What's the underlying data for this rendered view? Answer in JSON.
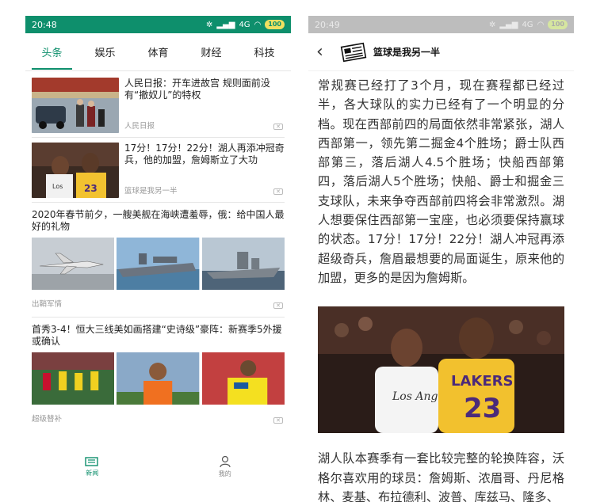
{
  "left": {
    "status": {
      "time": "20:48",
      "network": "4G",
      "battery": "100"
    },
    "tabs": [
      "头条",
      "娱乐",
      "体育",
      "财经",
      "科技"
    ],
    "news": [
      {
        "title": "人民日报：开车进故宫 规则面前没有“撤奴儿”的特权",
        "source": "人民日报"
      },
      {
        "title": "17分！17分！22分！湖人再添冲冠奇兵，他的加盟，詹姆斯立了大功",
        "source": "篮球是我另一半"
      },
      {
        "title": "2020年春节前夕，一艘美舰在海峡遭羞辱，俄：给中国人最好的礼物",
        "source": "出鞘军情"
      },
      {
        "title": "首秀3-4！恒大三线美如画搭建“史诗级”豪阵：新赛季5外援或确认",
        "source": "超级替补"
      }
    ],
    "nav": {
      "news": "新闻",
      "mine": "我的"
    }
  },
  "right": {
    "status": {
      "time": "20:49",
      "network": "4G",
      "battery": "100"
    },
    "header": {
      "title": "篮球是我另一半"
    },
    "paragraph1": "常规赛已经打了3个月，现在赛程都已经过半，各大球队的实力已经有了一个明显的分档。现在西部前四的局面依然非常紧张，湖人西部第一，领先第二掘金4个胜场；爵士队西部第三，落后湖人4.5个胜场；快船西部第四，落后湖人5个胜场；快船、爵士和掘金三支球队，未来争夺西部前四将会非常激烈。湖人想要保住西部第一宝座，也必须要保持赢球的状态。17分！17分！22分！湖人冲冠再添超级奇兵，詹眉最想要的局面诞生，原来他的加盟，更多的是因为詹姆斯。",
    "image_text": {
      "jersey_left": "Los Angeles",
      "jersey_right": "LAKERS",
      "number": "23"
    },
    "paragraph2": "湖人队本赛季有一套比较完整的轮换阵容，沃格尔喜欢用的球员：詹姆斯、浓眉哥、丹尼格林、麦基、布拉德利、波普、库兹马、隆多、"
  },
  "colors": {
    "brand": "#0e8f6c",
    "dim_status": "#bdbdbd"
  }
}
